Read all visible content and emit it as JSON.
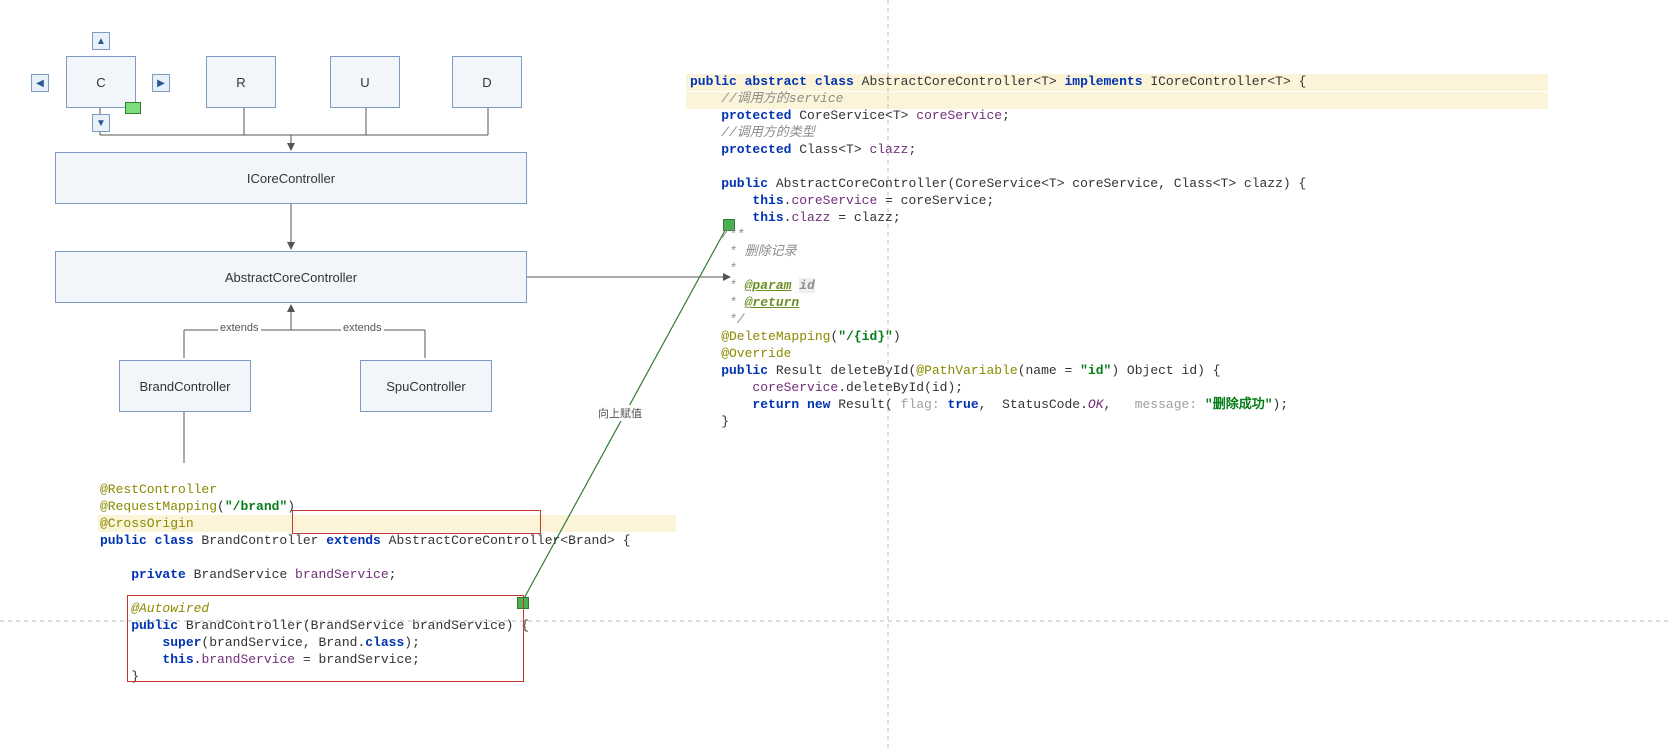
{
  "diagram": {
    "boxes": {
      "C": "C",
      "R": "R",
      "U": "U",
      "D": "D",
      "ICoreController": "ICoreController",
      "AbstractCoreController": "AbstractCoreController",
      "BrandController": "BrandController",
      "SpuController": "SpuController"
    },
    "edge_labels": {
      "extends_left": "extends",
      "extends_right": "extends",
      "up_value": "向上赋值"
    }
  },
  "code_left": {
    "l1": "@RestController",
    "l2_a": "@RequestMapping",
    "l2_b": "(",
    "l2_c": "\"/brand\"",
    "l2_d": ")",
    "l3": "@CrossOrigin",
    "l4_a": "public class ",
    "l4_b": "BrandController ",
    "l4_c": "extends ",
    "l4_d": "AbstractCoreController<Brand>",
    "l4_e": " {",
    "l5_a": "    private ",
    "l5_b": "BrandService ",
    "l5_c": "brandService",
    "l5_d": ";",
    "l6": "    @Autowired",
    "l7_a": "    public ",
    "l7_b": "BrandController(BrandService brandService) {",
    "l8_a": "        super",
    "l8_b": "(brandService, Brand.",
    "l8_c": "class",
    "l8_d": ");",
    "l9_a": "        this",
    "l9_b": ".",
    "l9_c": "brandService ",
    "l9_d": "= brandService;",
    "l10": "    }"
  },
  "code_right": {
    "l1_a": "public abstract class ",
    "l1_b": "AbstractCoreController<",
    "l1_c": "T",
    "l1_d": "> ",
    "l1_e": "implements ",
    "l1_f": "ICoreController<",
    "l1_g": "T",
    "l1_h": "> {",
    "l2": "    //调用方的service",
    "l3_a": "    protected ",
    "l3_b": "CoreService<",
    "l3_c": "T",
    "l3_d": "> ",
    "l3_e": "coreService",
    "l3_f": ";",
    "l4": "    //调用方的类型",
    "l5_a": "    protected ",
    "l5_b": "Class<",
    "l5_c": "T",
    "l5_d": "> ",
    "l5_e": "clazz",
    "l5_f": ";",
    "l6_a": "    public ",
    "l6_b": "AbstractCoreController(CoreService<",
    "l6_c": "T",
    "l6_d": "> coreService, Class<",
    "l6_e": "T",
    "l6_f": "> clazz) {",
    "l7_a": "        this",
    "l7_b": ".",
    "l7_c": "coreService ",
    "l7_d": "= coreService;",
    "l8_a": "        this",
    "l8_b": ".",
    "l8_c": "clazz ",
    "l8_d": "= clazz;",
    "l9": "    /**",
    "l10": "     * 删除记录",
    "l11": "     *",
    "l12_a": "     * ",
    "l12_b": "@param",
    "l12_c": " ",
    "l12_d": "id",
    "l13_a": "     * ",
    "l13_b": "@return",
    "l14": "     */",
    "l15_a": "    @DeleteMapping",
    "l15_b": "(",
    "l15_c": "\"/{id}\"",
    "l15_d": ")",
    "l16": "    @Override",
    "l17_a": "    public ",
    "l17_b": "Result deleteById(",
    "l17_c": "@PathVariable",
    "l17_d": "(name = ",
    "l17_e": "\"id\"",
    "l17_f": ") Object id) {",
    "l18_a": "        ",
    "l18_b": "coreService",
    "l18_c": ".deleteById(id);",
    "l19_a": "        return new ",
    "l19_b": "Result(",
    "l19_c": " flag: ",
    "l19_d": "true",
    "l19_e": ",  StatusCode.",
    "l19_f": "OK",
    "l19_g": ",  ",
    "l19_h": " message: ",
    "l19_i": "\"删除成功\"",
    "l19_j": ");",
    "l20": "    }"
  }
}
